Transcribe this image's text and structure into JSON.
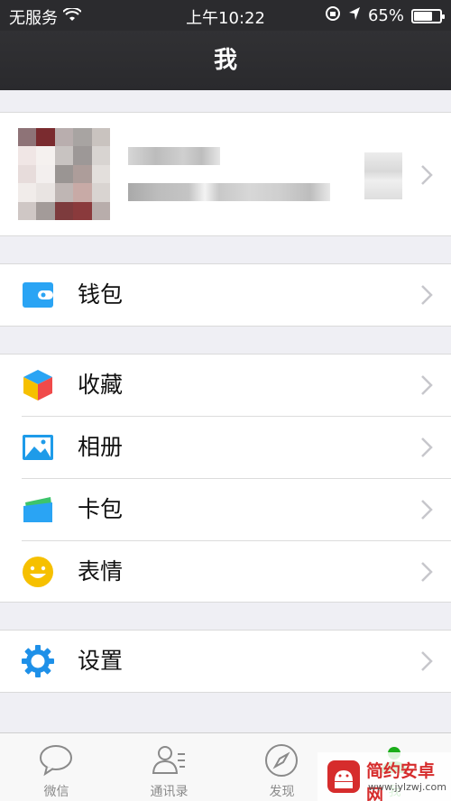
{
  "status_bar": {
    "carrier": "无服务",
    "time": "上午10:22",
    "battery_percent": "65%",
    "battery_level": 0.65
  },
  "nav": {
    "title": "我"
  },
  "profile": {
    "note": ""
  },
  "menu": {
    "wallet": "钱包",
    "favorites": "收藏",
    "album": "相册",
    "cards": "卡包",
    "stickers": "表情",
    "settings": "设置"
  },
  "tabs": [
    "微信",
    "通讯录",
    "发现",
    "我"
  ],
  "watermark": {
    "title": "简约安卓网",
    "url": "www.jylzwj.com"
  },
  "colors": {
    "accent": "#1aad19",
    "wallet_blue": "#2aa4f4",
    "settings_blue": "#1e90e8",
    "sticker_yellow": "#f6c000"
  }
}
